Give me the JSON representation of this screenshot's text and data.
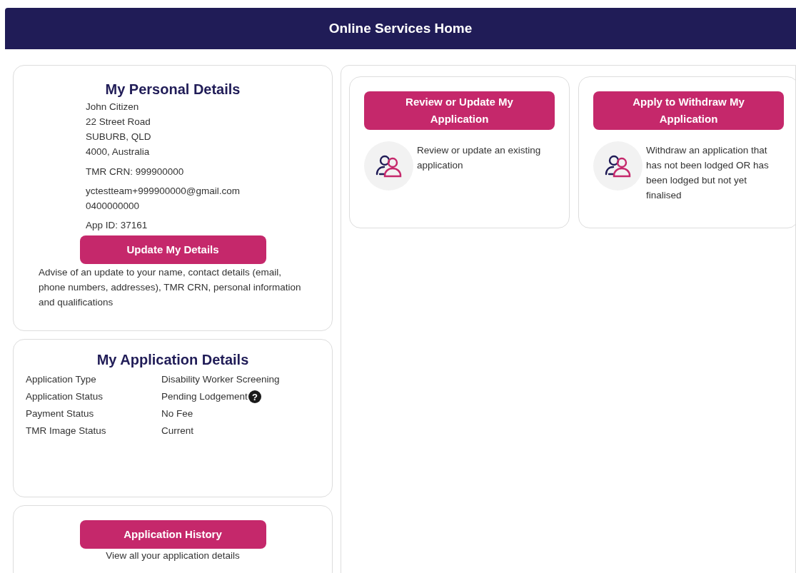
{
  "header": {
    "title": "Online Services Home"
  },
  "personal_details": {
    "title": "My Personal Details",
    "address_lines": [
      "John Citizen",
      "22 Street Road",
      "SUBURB, QLD",
      "4000, Australia"
    ],
    "crn": "TMR CRN: 999900000",
    "contact_lines": [
      "yctestteam+999900000@gmail.com",
      "0400000000"
    ],
    "app_id": "App ID: 37161",
    "button": "Update My Details",
    "description": "Advise of an update to your name, contact details (email, phone numbers, addresses), TMR CRN, personal information and qualifications"
  },
  "application_details": {
    "title": "My Application Details",
    "rows": [
      {
        "label": "Application Type",
        "value": "Disability Worker Screening"
      },
      {
        "label": "Application Status",
        "value": "Pending Lodgement",
        "help": "?"
      },
      {
        "label": "Payment Status",
        "value": "No Fee"
      },
      {
        "label": "TMR Image Status",
        "value": "Current"
      }
    ]
  },
  "history": {
    "button": "Application History",
    "description": "View all your application details"
  },
  "actions": [
    {
      "button": "Review or Update My Application",
      "description": "Review or update an existing application"
    },
    {
      "button": "Apply to Withdraw My Application",
      "description": "Withdraw an application that has not been lodged OR has been lodged but not yet finalised"
    }
  ]
}
